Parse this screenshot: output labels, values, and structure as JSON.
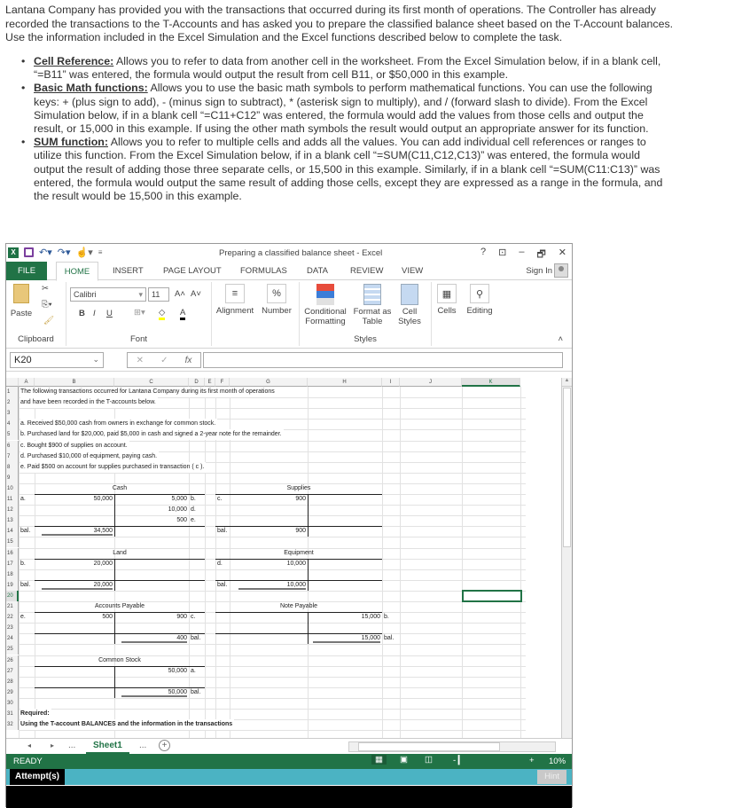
{
  "intro": "Lantana Company has provided you with the transactions that occurred during its first month of operations.  The Controller has already recorded the transactions to the T-Accounts and has asked you to prepare the classified balance sheet based on the T-Account balances.  Use the information included in the Excel Simulation and the Excel functions described below to complete the task.",
  "bullets": [
    {
      "term": "Cell Reference:",
      "text": " Allows you to refer to data from another cell in the worksheet.  From the Excel Simulation below, if in a blank cell, “=B11” was entered, the formula would output the result from cell B11, or $50,000 in this example."
    },
    {
      "term": "Basic Math functions:",
      "text": " Allows you to use the basic math symbols to perform mathematical functions.  You can use the following keys:  + (plus sign to add), - (minus sign to subtract), * (asterisk sign to multiply), and / (forward slash to divide).  From the Excel Simulation below, if in a blank cell “=C11+C12” was entered, the formula would add the values from those cells and output the result, or 15,000 in this example.  If using the other math symbols the result would output an appropriate answer for its function."
    },
    {
      "term": "SUM function:",
      "text": " Allows you to refer to multiple cells and adds all the values.  You can add individual cell references or ranges to utilize this function.  From the Excel Simulation below, if in a blank cell “=SUM(C11,C12,C13)” was entered, the formula would output the result of adding those three separate cells, or 15,500 in this example.  Similarly, if in a blank cell “=SUM(C11:C13)” was entered, the formula would output the same result of adding those cells, except they are expressed as a range in the formula, and the result would be 15,500 in this example."
    }
  ],
  "excel": {
    "title": "Preparing a classified balance sheet - Excel",
    "window_controls": {
      "help": "?",
      "ribbon_opts": "⊡",
      "minimize": "–",
      "restore": "🗗",
      "close": "✕"
    },
    "tabs": [
      "FILE",
      "HOME",
      "INSERT",
      "PAGE LAYOUT",
      "FORMULAS",
      "DATA",
      "REVIEW",
      "VIEW"
    ],
    "sign_in": "Sign In",
    "ribbon": {
      "paste": "Paste",
      "clipboard": "Clipboard",
      "font_name": "Calibri",
      "font_size": "11",
      "bold": "B",
      "italic": "I",
      "underline": "U",
      "font": "Font",
      "alignment": "Alignment",
      "number": "Number",
      "conditional_formatting": "Conditional Formatting",
      "format_as_table": "Format as Table",
      "cell_styles": "Cell Styles",
      "styles": "Styles",
      "cells": "Cells",
      "editing": "Editing"
    },
    "name_box": "K20",
    "formula_value": "",
    "columns": [
      "A",
      "B",
      "C",
      "D",
      "E",
      "F",
      "G",
      "H",
      "I",
      "J",
      "K"
    ],
    "rows": [
      "1",
      "2",
      "3",
      "4",
      "5",
      "6",
      "7",
      "8",
      "9",
      "10",
      "11",
      "12",
      "13",
      "14",
      "15",
      "16",
      "17",
      "18",
      "19",
      "20",
      "21",
      "22",
      "23",
      "24",
      "25",
      "26",
      "27",
      "28",
      "29",
      "30",
      "31",
      "32"
    ],
    "text_rows": {
      "r1": "The following transactions occurred for Lantana Company during its first month of operations",
      "r2": "and have been recorded in the T-accounts below.",
      "r4": "a. Received $50,000 cash from owners in exchange for common stock.",
      "r5": "b. Purchased land for $20,000, paid $5,000 in cash and signed a 2-year note for the remainder.",
      "r6": "c. Bought $900 of supplies on account.",
      "r7": "d. Purchased $10,000 of equipment, paying cash.",
      "r8": "e. Paid $500 on account for supplies purchased in transaction ( c ).",
      "r31": "Required:",
      "r32": "Using the T-account BALANCES and the information in the transactions"
    },
    "taccounts": {
      "cash": {
        "title": "Cash",
        "d1": "a.",
        "v1": "50,000",
        "c1": "5,000",
        "l1": "b.",
        "c2": "10,000",
        "l2": "d.",
        "c3": "500",
        "l3": "e.",
        "bal_label": "bal.",
        "bal": "34,500"
      },
      "supplies": {
        "title": "Supplies",
        "d1": "c.",
        "v1": "900",
        "bal_label": "bal.",
        "bal": "900"
      },
      "land": {
        "title": "Land",
        "d1": "b.",
        "v1": "20,000",
        "bal_label": "bal.",
        "bal": "20,000"
      },
      "equipment": {
        "title": "Equipment",
        "d1": "d.",
        "v1": "10,000",
        "bal_label": "bal.",
        "bal": "10,000"
      },
      "ap": {
        "title": "Accounts Payable",
        "d1": "e.",
        "v1": "500",
        "c1": "900",
        "l1": "c.",
        "bal": "400",
        "bal_label": "bal."
      },
      "np": {
        "title": "Note Payable",
        "c1": "15,000",
        "l1": "b.",
        "bal": "15,000",
        "bal_label": "bal."
      },
      "cs": {
        "title": "Common Stock",
        "c1": "50,000",
        "l1": "a.",
        "bal": "50,000",
        "bal_label": "bal."
      }
    },
    "sheet_tab": "Sheet1",
    "ellipsis": "...",
    "status": "READY",
    "zoom": "10%",
    "attempts": "Attempt(s)",
    "hint": "Hint"
  }
}
